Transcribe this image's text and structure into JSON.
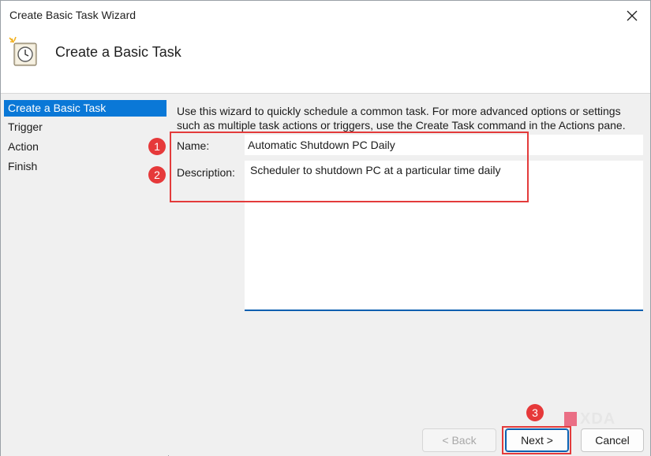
{
  "window": {
    "title": "Create Basic Task Wizard",
    "close_icon": "close-icon"
  },
  "header": {
    "title": "Create a Basic Task",
    "icon": "task-clock-icon"
  },
  "sidebar": {
    "items": [
      {
        "label": "Create a Basic Task",
        "active": true
      },
      {
        "label": "Trigger",
        "active": false
      },
      {
        "label": "Action",
        "active": false
      },
      {
        "label": "Finish",
        "active": false
      }
    ]
  },
  "content": {
    "intro_line1": "Use this wizard to quickly schedule a common task.  For more advanced options or settings",
    "intro_line2": "such as multiple task actions or triggers, use the Create Task command in the Actions pane.",
    "name_label": "Name:",
    "name_value": "Automatic Shutdown PC Daily",
    "description_label": "Description:",
    "description_value": "Scheduler to shutdown PC at a particular time daily"
  },
  "annotations": {
    "badge1": "1",
    "badge2": "2",
    "badge3": "3",
    "color": "#e33b3b"
  },
  "buttons": {
    "back": "< Back",
    "next": "Next >",
    "cancel": "Cancel"
  },
  "watermark": {
    "text": "XDA"
  },
  "colors": {
    "accent": "#0a78d7",
    "annotation_red": "#e33b3b"
  }
}
